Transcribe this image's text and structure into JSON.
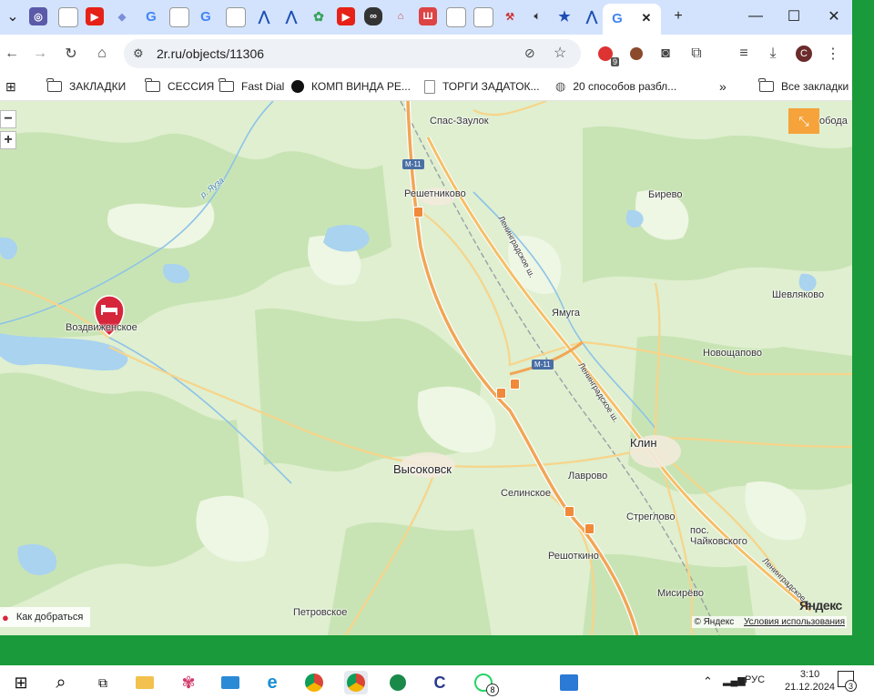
{
  "browser": {
    "url": "2r.ru/objects/11306",
    "window_controls": {
      "minimize": "—",
      "maximize": "☐",
      "close": "✕"
    },
    "new_tab_symbol": "+",
    "extension_badge": "9",
    "profile_initial": "С"
  },
  "bookmarks": [
    {
      "label": "ЗАКЛАДКИ",
      "icon": "folder-icon"
    },
    {
      "label": "СЕССИЯ",
      "icon": "folder-icon"
    },
    {
      "label": "Fast Dial",
      "icon": "folder-icon"
    },
    {
      "label": "КОМП ВИНДА РЕ...",
      "icon": "ebay-icon"
    },
    {
      "label": "ТОРГИ ЗАДАТОК...",
      "icon": "document-icon"
    },
    {
      "label": "20 способов разбл...",
      "icon": "globe-icon"
    }
  ],
  "bookmarks_more": "»",
  "all_bookmarks": "Все закладки",
  "map": {
    "labels": {
      "spas_zaulok": "Спас-Заулок",
      "svoboda": "обода",
      "reshetnikovo": "Решетниково",
      "birevo": "Бирево",
      "vozdvizhenskoe": "Воздвиженское",
      "shevlyakovo": "Шевляково",
      "yamuga": "Ямуга",
      "novoshchapovo": "Новощапово",
      "klin": "Клин",
      "vysokovsk": "Высоковск",
      "lavrovo": "Лаврово",
      "selinskoe": "Селинское",
      "streglovo": "Стреглово",
      "chaykovskogo": "пос.\nЧайковского",
      "reshotkino": "Решоткино",
      "misirevo": "Мисирёво",
      "petrovskoe": "Петровское",
      "yauza": "р. Яуза",
      "leningradskoe_1": "Ленинградское ш.",
      "leningradskoe_2": "Ленинградское ш.",
      "leningradskoe_3": "Ленинградское ш."
    },
    "highway_shield": "M-11",
    "zoom_out": "−",
    "zoom_in": "+",
    "route_link": "Как добраться",
    "copyright": "© Яндекс",
    "terms": "Условия использования",
    "logo": "Яндекс"
  },
  "taskbar": {
    "time": "3:10",
    "date": "21.12.2024",
    "language": "РУС",
    "whatsapp_badge": "8",
    "notifications_badge": "3"
  },
  "colors": {
    "tab_strip": "#d3e3fd",
    "map_land": "#dfefd0",
    "forest": "#c9e4b4",
    "water": "#a9d3ef",
    "major_road": "#f1a656",
    "minor_road": "#f7d48a",
    "marker": "#d6263b",
    "desktop": "#1a9a3a"
  }
}
